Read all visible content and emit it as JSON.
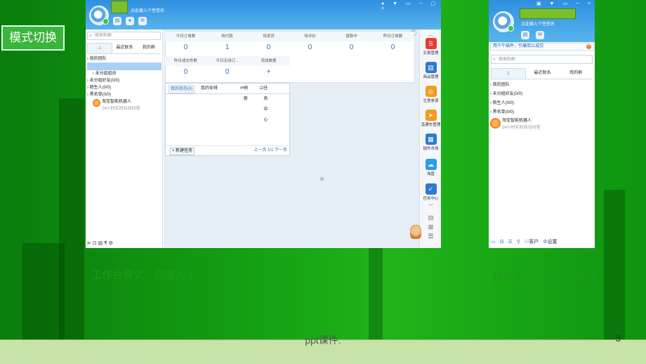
{
  "slide": {
    "mode_label": "模式切换",
    "footer": "ppt课件.",
    "page_number": "3",
    "caption_left": "工作台模式：商家为主",
    "caption_right": "精简模式：以聊天为主"
  },
  "left_window": {
    "signature": "点此输入个性签名",
    "search_placeholder": "搜索和群",
    "tabs": [
      "",
      "最近联系",
      "我的群"
    ],
    "tree": [
      "我的团队",
      "",
      "未分组组员",
      "未分组好友(0/0)",
      "陌生人(0/0)",
      "黑名单(0/0)"
    ],
    "robot_name": "淘宝智能机器人",
    "robot_sub": "24小时实时自动问答",
    "window_controls": "● ▼ ▭ ─ ▢ ×"
  },
  "stats": {
    "row1": [
      {
        "label": "今日订单数",
        "value": "0"
      },
      {
        "label": "待付款",
        "value": "1"
      },
      {
        "label": "待发货",
        "value": "0"
      },
      {
        "label": "待评价",
        "value": "0"
      },
      {
        "label": "退款中",
        "value": "0"
      },
      {
        "label": "昨日订单数",
        "value": "0"
      }
    ],
    "row2": [
      {
        "label": "昨日成交件数",
        "value": "0"
      },
      {
        "label": "今日无线订...",
        "value": "0"
      },
      {
        "label": "添加数据",
        "value": "+"
      }
    ]
  },
  "todo": {
    "tab1": "我的待办(0)",
    "tab2": "我的安排",
    "refresh": "刷新",
    "task_center": "任务中心",
    "new_task": "+ 新建任务",
    "pager": "上一页 1/1 下一页"
  },
  "rail": [
    {
      "label": "交易管理",
      "icon": "S",
      "color": "#e83a3a"
    },
    {
      "label": "商品管理",
      "icon": "▤",
      "color": "#2c7bd1"
    },
    {
      "label": "生意参谋",
      "icon": "◎",
      "color": "#f29b1d"
    },
    {
      "label": "直通车管理",
      "icon": "➤",
      "color": "#f29b1d"
    },
    {
      "label": "插件市场",
      "icon": "▦",
      "color": "#2c7bd1"
    },
    {
      "label": "淘盘",
      "icon": "☁",
      "color": "#2c9be8"
    },
    {
      "label": "任务中心",
      "icon": "✓",
      "color": "#2c7bd1"
    }
  ],
  "right_window": {
    "signature": "点此输入个性签名",
    "notice": "用千牛插件，引爆双11成交",
    "search_placeholder": "搜索和群",
    "tabs": [
      "",
      "最近联系",
      "我的群"
    ],
    "tree": [
      "我的团队",
      "未分组好友(0/0)",
      "陌生人(0/0)",
      "黑名单(0/0)"
    ],
    "robot_name": "淘宝智能机器人",
    "robot_sub": "24小时实时自动问答",
    "bottom": [
      "客户",
      "设置"
    ],
    "window_controls": "▣ ▼ ▭ ─ ×"
  },
  "colors": {
    "slide_green": "#16a514",
    "qianniu_blue": "#2f8fe0",
    "footer_band": "#c8e3a8"
  }
}
